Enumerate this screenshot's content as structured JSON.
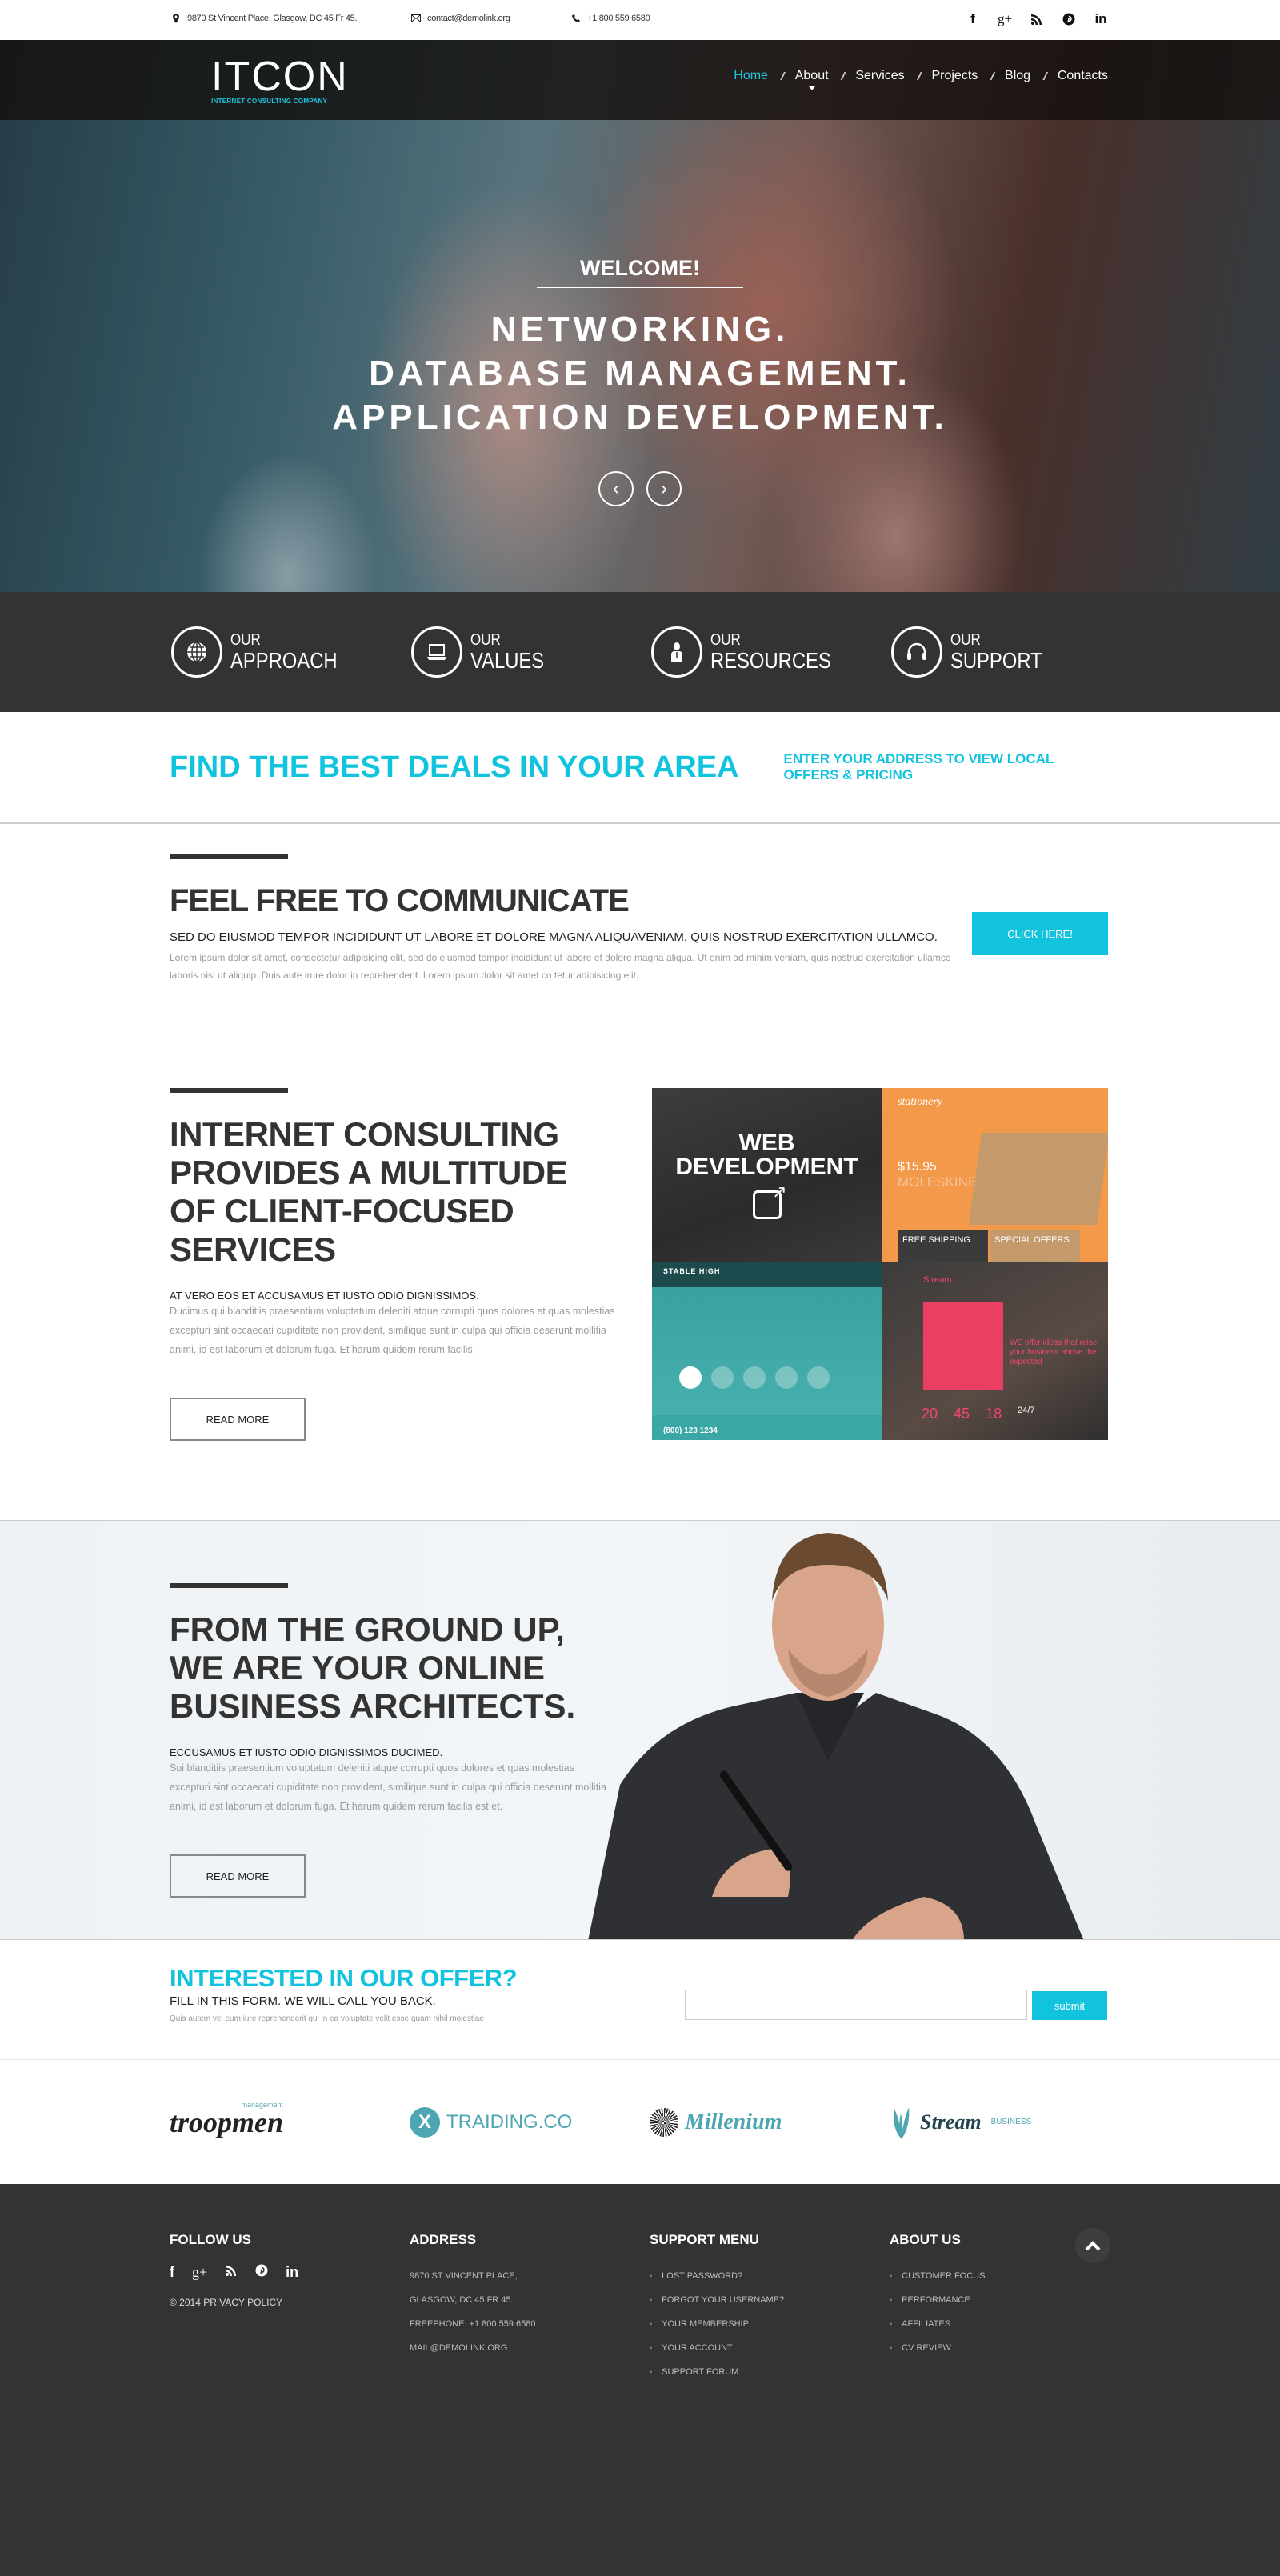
{
  "topbar": {
    "address": "9870 St Vincent Place, Glasgow, DC 45 Fr 45.",
    "email": "contact@demolink.org",
    "phone": "+1 800 559 6580",
    "social": [
      "facebook",
      "google-plus",
      "rss",
      "pinterest",
      "linkedin"
    ],
    "social_glyphs": [
      "f",
      "g+",
      "◥",
      "Ⓟ",
      "in"
    ]
  },
  "header": {
    "logo": "ITCON",
    "tagline": "INTERNET CONSULTING COMPANY",
    "menu": [
      {
        "label": "Home",
        "active": true
      },
      {
        "label": "About",
        "has_dropdown": true
      },
      {
        "label": "Services"
      },
      {
        "label": "Projects"
      },
      {
        "label": "Blog"
      },
      {
        "label": "Contacts"
      }
    ],
    "separator": "//"
  },
  "hero": {
    "welcome": "WELCOME!",
    "lines": [
      "NETWORKING.",
      "DATABASE MANAGEMENT.",
      "APPLICATION DEVELOPMENT."
    ],
    "prev": "‹",
    "next": "›"
  },
  "features": [
    {
      "small": "OUR",
      "big": "APPROACH",
      "icon": "globe-icon"
    },
    {
      "small": "OUR",
      "big": "VALUES",
      "icon": "laptop-icon"
    },
    {
      "small": "OUR",
      "big": "RESOURCES",
      "icon": "person-icon"
    },
    {
      "small": "OUR",
      "big": "SUPPORT",
      "icon": "headset-icon"
    }
  ],
  "deals": {
    "title": "FIND THE BEST DEALS IN YOUR AREA",
    "subtitle": "ENTER YOUR ADDRESS TO VIEW LOCAL OFFERS & PRICING"
  },
  "communicate": {
    "title": "FEEL FREE TO COMMUNICATE",
    "lead": "SED DO EIUSMOD TEMPOR INCIDIDUNT UT LABORE ET DOLORE MAGNA ALIQUAVENIAM, QUIS NOSTRUD EXERCITATION ULLAMCO.",
    "body": "Lorem ipsum dolor sit amet, consectetur adipisicing elit, sed do eiusmod tempor incididunt ut labore et dolore magna aliqua. Ut enim ad minim veniam, quis nostrud exercitation ullamco laboris nisi ut aliquip. Duis aute irure dolor in reprehenderit. Lorem ipsum dolor sit amet co tetur adipisicing elit.",
    "button": "CLICK HERE!"
  },
  "services": {
    "title": "INTERNET CONSULTING PROVIDES A MULTITUDE OF CLIENT-FOCUSED SERVICES",
    "lead": "AT VERO EOS ET ACCUSAMUS ET IUSTO ODIO DIGNISSIMOS.",
    "body": "Ducimus qui blanditiis praesentium voluptatum deleniti atque corrupti quos dolores et quas molestias excepturi sint occaecati cupiditate non provident, similique sunt in culpa qui officia deserunt mollitia animi, id est laborum et dolorum fuga. Et harum quidem rerum facilis.",
    "button": "READ MORE",
    "gallery": {
      "overlay_title": "WEB DEVELOPMENT",
      "stationery": {
        "brand": "stationery",
        "price": "$15.95",
        "product": "MOLESKINE",
        "box1": "FREE SHIPPING",
        "box2": "SPECIAL OFFERS"
      },
      "stable": {
        "name": "STABLE HIGH",
        "phone": "(800) 123 1234"
      },
      "stream": {
        "name": "Stream",
        "text": "WE offer ideas that raise your business above the expected",
        "stats": [
          "20",
          "45",
          "18",
          "24/7"
        ]
      }
    }
  },
  "architects": {
    "title": "FROM THE GROUND UP, WE ARE YOUR ONLINE BUSINESS ARCHITECTS.",
    "lead": "ECCUSAMUS ET IUSTO ODIO DIGNISSIMOS DUCIMED.",
    "body": "Sui blanditiis praesentium voluptatum deleniti atque corrupti quos dolores et quas molestias excepturi sint occaecati cupiditate non provident, similique sunt in culpa qui officia deserunt mollitia animi, id est laborum et dolorum fuga. Et harum quidem rerum facilis est et.",
    "button": "READ MORE"
  },
  "offer": {
    "title": "INTERESTED IN OUR OFFER?",
    "subtitle": "FILL IN THIS FORM. WE WILL CALL YOU BACK.",
    "note": "Quis autem vel eum iure reprehenderit qui in ea voluptate velit esse quam nihil molestiae",
    "input_value": "",
    "submit": "submit"
  },
  "partners": {
    "troopmen": {
      "name": "troopmen",
      "tag": "management"
    },
    "traiding": {
      "badge": "X",
      "name": "TRAIDING.CO"
    },
    "millenium": {
      "name": "Millenium"
    },
    "stream": {
      "name": "Stream",
      "tag": "BUSINESS"
    }
  },
  "footer": {
    "follow": {
      "title": "FOLLOW US",
      "glyphs": [
        "f",
        "g+",
        "◥",
        "Ⓟ",
        "in"
      ],
      "copyright": "© 2014 PRIVACY POLICY"
    },
    "address": {
      "title": "ADDRESS",
      "lines": [
        "9870 ST VINCENT PLACE,",
        "GLASGOW, DC 45 FR 45.",
        "FREEPHONE:  +1 800 559 6580",
        "MAIL@DEMOLINK.ORG"
      ]
    },
    "support": {
      "title": "SUPPORT MENU",
      "items": [
        "LOST PASSWORD?",
        "FORGOT YOUR USERNAME?",
        "YOUR MEMBERSHIP",
        "YOUR ACCOUNT",
        "SUPPORT FORUM"
      ]
    },
    "about": {
      "title": "ABOUT US",
      "items": [
        "CUSTOMER FOCUS",
        "PERFORMANCE",
        "AFFILIATES",
        "CV REVIEW"
      ]
    }
  },
  "colors": {
    "accent": "#12c3de",
    "dark": "#333333",
    "muted": "#999999"
  }
}
